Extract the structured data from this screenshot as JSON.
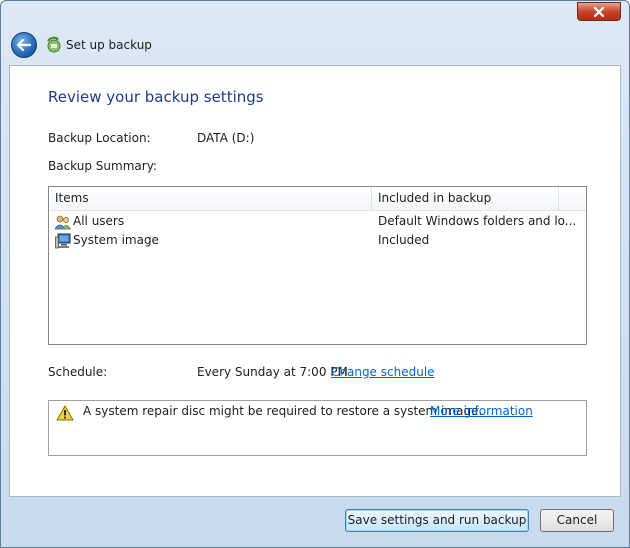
{
  "nav": {
    "title": "Set up backup"
  },
  "page": {
    "heading": "Review your backup settings",
    "location_label": "Backup Location:",
    "location_value": "DATA (D:)",
    "summary_label": "Backup Summary:",
    "table": {
      "columns": [
        "Items",
        "Included in backup"
      ],
      "rows": [
        {
          "item": "All users",
          "included": "Default Windows folders and lo...",
          "icon": "users-icon"
        },
        {
          "item": "System image",
          "included": "Included",
          "icon": "computer-icon"
        }
      ]
    },
    "schedule_label": "Schedule:",
    "schedule_value": "Every Sunday at 7:00 PM",
    "change_schedule": "Change schedule",
    "warning_text": "A system repair disc might be required to restore a system image.",
    "more_info": "More information"
  },
  "footer": {
    "save_label": "Save settings and run backup",
    "cancel_label": "Cancel"
  },
  "colors": {
    "heading": "#1a3e8c",
    "link": "#0066cc",
    "close": "#c7452b"
  }
}
